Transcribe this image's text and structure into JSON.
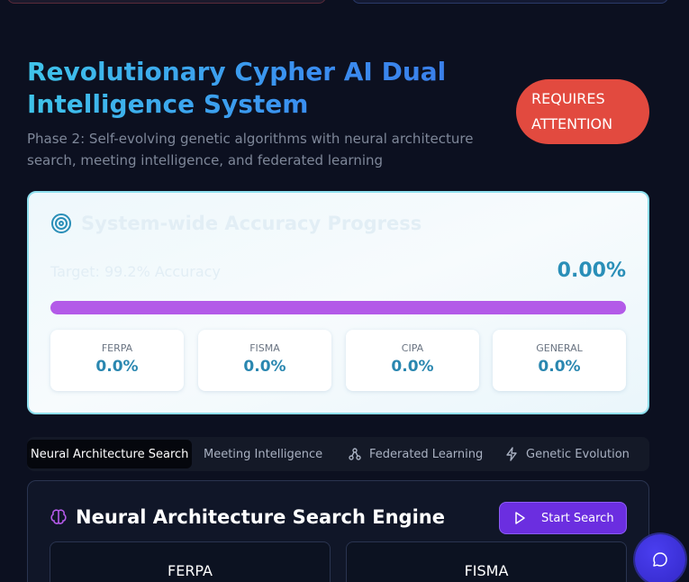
{
  "header": {
    "title": "Revolutionary Cypher AI Dual Intelligence System",
    "subtitle": "Phase 2: Self-evolving genetic algorithms with neural architecture search, meeting intelligence, and federated learning",
    "status_badge": "REQUIRES ATTENTION"
  },
  "accuracy": {
    "title": "System-wide Accuracy Progress",
    "icon": "target-icon",
    "target_label": "Target: 99.2% Accuracy",
    "current_percent": "0.00%",
    "progress_fraction": 1.0,
    "stats": [
      {
        "label": "FERPA",
        "value": "0.0%"
      },
      {
        "label": "FISMA",
        "value": "0.0%"
      },
      {
        "label": "CIPA",
        "value": "0.0%"
      },
      {
        "label": "GENERAL",
        "value": "0.0%"
      }
    ]
  },
  "tabs": [
    {
      "label": "Neural Architecture Search",
      "active": true
    },
    {
      "label": "Meeting Intelligence",
      "active": false
    },
    {
      "label": "Federated Learning",
      "icon": "network-icon",
      "active": false
    },
    {
      "label": "Genetic Evolution",
      "icon": "lightning-icon",
      "active": false
    }
  ],
  "nas": {
    "title": "Neural Architecture Search Engine",
    "icon": "brain-icon",
    "start_button": "Start Search",
    "cards": [
      {
        "label": "FERPA"
      },
      {
        "label": "FISMA"
      }
    ]
  },
  "colors": {
    "accent": "#6b2ee0",
    "badge": "#e24a3f",
    "progress": "#b35ae8",
    "stat_value": "#2a87b0"
  }
}
